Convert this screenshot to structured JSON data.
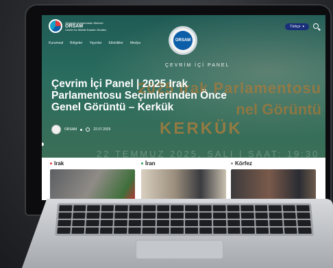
{
  "brand": {
    "line1": "Ortadoğu Araştırmaları Merkezi",
    "name": "ORSAM",
    "line2": "Center for Middle Eastern Studies"
  },
  "header": {
    "language": "Türkçe"
  },
  "nav": [
    {
      "label": "Kurumsal"
    },
    {
      "label": "Bölgeler"
    },
    {
      "label": "Yayınlar"
    },
    {
      "label": "Etkinlikler"
    },
    {
      "label": "Medya"
    }
  ],
  "hero": {
    "seal_text": "ORSAM",
    "panel_label": "ÇEVRİM İÇİ PANEL",
    "headline": "Çevrim İçi Panel | 2025 Irak Parlamentosu Seçimlerinden Önce Genel Görüntü – Kerkük",
    "bg_text_1": "2025 Irak Parlamentosu",
    "bg_text_2": "nel Görüntü",
    "bg_text_3": "KERKÜK",
    "bg_text_4": "22 TEMMUZ 2025, SALI | SAAT: 19:30",
    "author": "ORSAM",
    "date": "22.07.2025"
  },
  "categories": [
    {
      "label": "Irak",
      "bullet_color": "#e23b3b",
      "thumb_color": "#6b6e72"
    },
    {
      "label": "İran",
      "bullet_color": "#2e9e4f",
      "thumb_color": "#8a7a6a"
    },
    {
      "label": "Körfez",
      "bullet_color": "#8a8d91",
      "thumb_color": "#5a4e48"
    }
  ]
}
